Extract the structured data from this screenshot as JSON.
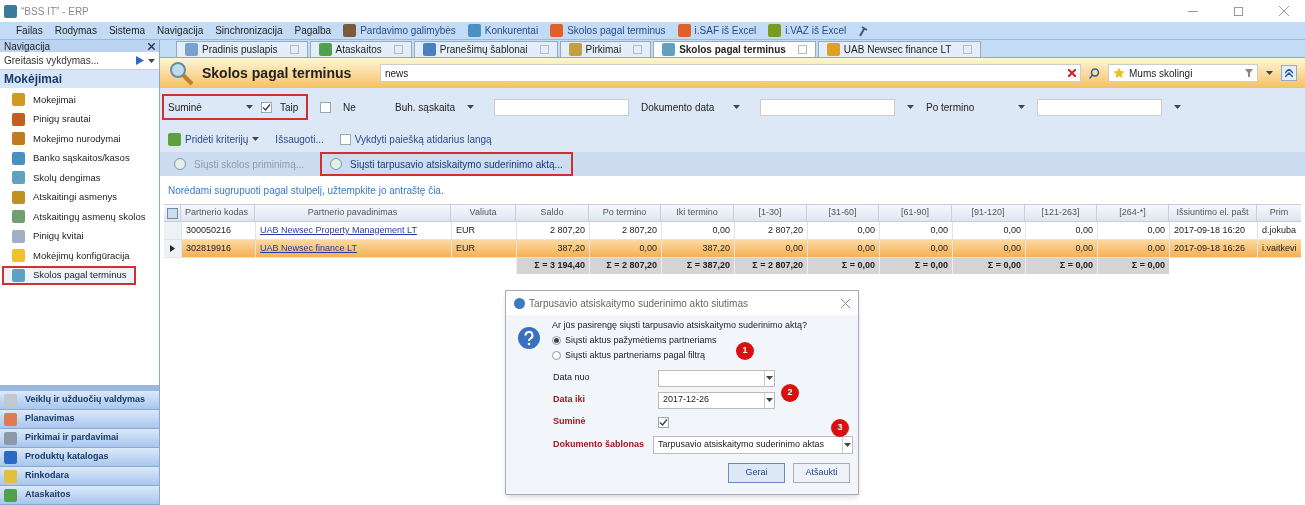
{
  "window": {
    "title": "“BSS IT” - ERP"
  },
  "menu": [
    {
      "label": "Failas",
      "kind": "text"
    },
    {
      "label": "Rodymas",
      "kind": "text"
    },
    {
      "label": "Sistema",
      "kind": "text"
    },
    {
      "label": "Navigacija",
      "kind": "text"
    },
    {
      "label": "Sinchronizacija",
      "kind": "text"
    },
    {
      "label": "Pagalba",
      "kind": "text"
    },
    {
      "label": "Pardavimo galimybės",
      "kind": "icon"
    },
    {
      "label": "Konkurentai",
      "kind": "icon"
    },
    {
      "label": "Skolos pagal terminus",
      "kind": "icon"
    },
    {
      "label": "i.SAF iš Excel",
      "kind": "icon"
    },
    {
      "label": "i.VAZ iš Excel",
      "kind": "icon"
    }
  ],
  "sidebar": {
    "title": "Navigacija",
    "quick": {
      "placeholder": "Greitasis vykdymas..."
    },
    "section": "Mokėjimai",
    "items": [
      {
        "label": "Mokejimai",
        "selected": false,
        "highlighted": false
      },
      {
        "label": "Pinigų srautai",
        "selected": false,
        "highlighted": false
      },
      {
        "label": "Mokejimo nurodymai",
        "selected": false,
        "highlighted": false
      },
      {
        "label": "Banko sąskaitos/kasos",
        "selected": false,
        "highlighted": false
      },
      {
        "label": "Skolų dengimas",
        "selected": false,
        "highlighted": false
      },
      {
        "label": "Atskaitingi asmenys",
        "selected": false,
        "highlighted": false
      },
      {
        "label": "Atskaitingų asmenų skolos",
        "selected": false,
        "highlighted": false
      },
      {
        "label": "Pinigų kvitai",
        "selected": false,
        "highlighted": false
      },
      {
        "label": "Mokėjimų konfigūracija",
        "selected": false,
        "highlighted": false
      },
      {
        "label": "Skolos pagal terminus",
        "selected": true,
        "highlighted": true
      }
    ],
    "modules": [
      "Veiklų ir užduočių valdymas",
      "Planavimas",
      "Pirkimai ir pardavimai",
      "Produktų katalogas",
      "Rinkodara",
      "Ataskaitos"
    ]
  },
  "tabs": [
    {
      "label": "Pradinis puslapis",
      "selected": false
    },
    {
      "label": "Ataskaitos",
      "selected": false
    },
    {
      "label": "Pranešimų šablonai",
      "selected": false
    },
    {
      "label": "Pirkimai",
      "selected": false
    },
    {
      "label": "Skolos pagal terminus",
      "selected": true
    },
    {
      "label": "UAB Newsec finance LT",
      "selected": false
    }
  ],
  "header": {
    "title": "Skolos pagal terminus",
    "search": "news",
    "filter": "Mums skolingi"
  },
  "filters": {
    "sum": {
      "label": "Suminė",
      "highlighted": true
    },
    "yes": {
      "label": "Taip",
      "checked": true
    },
    "no": {
      "label": "Ne",
      "checked": false
    },
    "account": "Buh. sąskaita",
    "doc_date": "Dokumento data",
    "overdue": "Po termino"
  },
  "toolbar": {
    "add": "Pridėti kriterijų",
    "save": "Išsaugoti...",
    "run_on_open": {
      "label": "Vykdyti paiešką atidarius langą",
      "checked": false
    }
  },
  "actions": [
    {
      "label": "Siųsti skolos priminimą...",
      "highlighted": false,
      "disabled": true
    },
    {
      "label": "Siųsti tarpusavio atsiskaitymo suderinimo aktą...",
      "highlighted": true,
      "disabled": false
    }
  ],
  "group_hint": "Norėdami sugrupuoti pagal stulpelį, užtempkite jo antraštę čia.",
  "table": {
    "columns": [
      "Partnerio kodas",
      "Partnerio pavadinimas",
      "Valiuta",
      "Saldo",
      "Po termino",
      "Iki termino",
      "[1-30]",
      "[31-60]",
      "[61-90]",
      "[91-120]",
      "[121-263]",
      "[264-*]",
      "Išsiuntimo el. pašt",
      "Prim"
    ],
    "rows": [
      {
        "selected": false,
        "cells": [
          "300050216",
          "UAB Newsec Property Management LT",
          "EUR",
          "2 807,20",
          "2 807,20",
          "0,00",
          "2 807,20",
          "0,00",
          "0,00",
          "0,00",
          "0,00",
          "0,00",
          "2017-09-18 16:20",
          "d.jokuba"
        ]
      },
      {
        "selected": true,
        "cells": [
          "302819916",
          "UAB Newsec finance LT",
          "EUR",
          "387,20",
          "0,00",
          "387,20",
          "0,00",
          "0,00",
          "0,00",
          "0,00",
          "0,00",
          "0,00",
          "2017-09-18 16:26",
          "i.vaitkevi"
        ]
      }
    ],
    "totals": [
      "Σ = 3 194,40",
      "Σ = 2 807,20",
      "Σ = 387,20",
      "Σ = 2 807,20",
      "Σ = 0,00",
      "Σ = 0,00",
      "Σ = 0,00",
      "Σ = 0,00",
      "Σ = 0,00"
    ]
  },
  "dialog": {
    "title": "Tarpusavio atsiskaitymo suderinimo akto siutimas",
    "question": "Ar jūs pasirengę siųsti tarpusavio atsiskaitymo suderinimo aktą?",
    "options": [
      {
        "label": "Siųsti aktus pažymėtiems partneriams",
        "selected": true
      },
      {
        "label": "Siųsti aktus partneriams pagal filtrą",
        "selected": false
      }
    ],
    "fields": [
      {
        "label": "Data nuo",
        "required": false
      },
      {
        "label": "Data iki",
        "value": "2017-12-26",
        "required": true
      }
    ],
    "sum": {
      "label": "Suminė",
      "checked": true
    },
    "template": {
      "label": "Dokumento šablonas",
      "value": "Tarpusavio atsiskaitymo suderinimo aktas"
    },
    "buttons": [
      "Gerai",
      "Atšaukti"
    ],
    "markers": [
      "1",
      "2",
      "3"
    ]
  }
}
